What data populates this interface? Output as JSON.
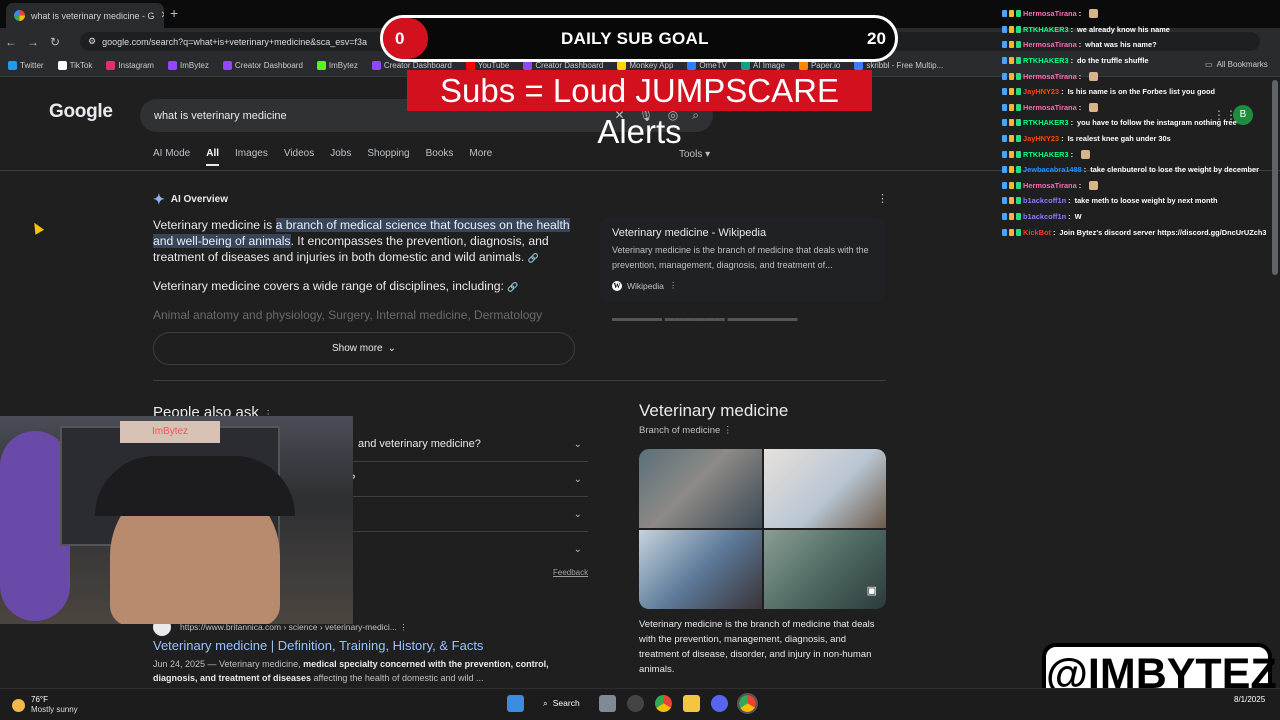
{
  "browser": {
    "tab_title": "what is veterinary medicine - G",
    "url": "google.com/search?q=what+is+veterinary+medicine&sca_esv=f3a",
    "bookmarks": [
      {
        "label": "Twitter",
        "color": "#1d9bf0"
      },
      {
        "label": "TikTok",
        "color": "#ffffff"
      },
      {
        "label": "Instagram",
        "color": "#e1306c"
      },
      {
        "label": "ImBytez",
        "color": "#9146ff"
      },
      {
        "label": "Creator Dashboard",
        "color": "#9146ff"
      },
      {
        "label": "ImBytez",
        "color": "#53fc18"
      },
      {
        "label": "Creator Dashboard",
        "color": "#9146ff"
      },
      {
        "label": "YouTube",
        "color": "#ff0000"
      },
      {
        "label": "Creator Dashboard",
        "color": "#9146ff"
      },
      {
        "label": "Monkey App",
        "color": "#ffd400"
      },
      {
        "label": "OmeTV",
        "color": "#2a7fff"
      },
      {
        "label": "AI Image",
        "color": "#10a37f"
      },
      {
        "label": "Paper.io",
        "color": "#ff8800"
      },
      {
        "label": "skribbl - Free Multip...",
        "color": "#3b7dff"
      }
    ],
    "all_bookmarks": "All Bookmarks"
  },
  "google": {
    "logo": "Google",
    "query": "what is veterinary medicine",
    "nav_tabs": [
      "AI Mode",
      "All",
      "Images",
      "Videos",
      "Jobs",
      "Shopping",
      "Books",
      "More"
    ],
    "active_tab": "All",
    "tools": "Tools",
    "ai_overview": {
      "heading": "AI Overview",
      "text_prefix": "Veterinary medicine is ",
      "text_highlight": "a branch of medical science that focuses on the health and well-being of animals",
      "text_suffix": ". It encompasses the prevention, diagnosis, and treatment of diseases and injuries in both domestic and wild animals.",
      "text2": "Veterinary medicine covers a wide range of disciplines, including:",
      "faded": "Animal anatomy and physiology, Surgery, Internal medicine, Dermatology",
      "show_more": "Show more"
    },
    "wiki_card": {
      "title": "Veterinary medicine - Wikipedia",
      "desc": "Veterinary medicine is the branch of medicine that deals with the prevention, management, diagnosis, and treatment of...",
      "source": "Wikipedia"
    },
    "people_also_ask": {
      "heading": "People also ask",
      "questions": [
        "and veterinary medicine?",
        "e?",
        "",
        ""
      ],
      "feedback": "Feedback"
    },
    "result": {
      "breadcrumb": "https://www.britannica.com › science › veterinary-medici...",
      "title": "Veterinary medicine | Definition, Training, History, & Facts",
      "date": "Jun 24, 2025 — Veterinary medicine, ",
      "bold1": "medical specialty concerned with the prevention, control, diagnosis, and treatment of diseases",
      "rest": " affecting the health of domestic and wild ..."
    },
    "knowledge_panel": {
      "title": "Veterinary medicine",
      "subtitle": "Branch of medicine",
      "desc": "Veterinary medicine is the branch of medicine that deals with the prevention, management, diagnosis, and treatment of disease, disorder, and injury in non-human animals."
    }
  },
  "overlay": {
    "goal_current": "0",
    "goal_label": "DAILY SUB GOAL",
    "goal_max": "20",
    "goal_progress": 0,
    "alert_text": "Subs = Loud JUMPSCARE Alerts",
    "webcam_sign": "ImBytez",
    "watermark": "@IMBYTEZ"
  },
  "chat": [
    {
      "user": "HermosaTirana",
      "color": "#ff69b4",
      "msg": ""
    },
    {
      "user": "RTKHAKER3",
      "color": "#00ff7f",
      "msg": "we already know his name"
    },
    {
      "user": "HermosaTirana",
      "color": "#ff69b4",
      "msg": "what was his name?"
    },
    {
      "user": "RTKHAKER3",
      "color": "#00ff7f",
      "msg": "do the truffle shuffle"
    },
    {
      "user": "HermosaTirana",
      "color": "#ff69b4",
      "msg": ""
    },
    {
      "user": "JayHNY23",
      "color": "#ff4500",
      "msg": "Is his name is on the Forbes list you good"
    },
    {
      "user": "HermosaTirana",
      "color": "#ff69b4",
      "msg": ""
    },
    {
      "user": "RTKHAKER3",
      "color": "#00ff7f",
      "msg": "you have to follow the instagram nothing free"
    },
    {
      "user": "JayHNY23",
      "color": "#ff4500",
      "msg": "Is realest knee gah under 30s"
    },
    {
      "user": "RTKHAKER3",
      "color": "#00ff7f",
      "msg": ""
    },
    {
      "user": "Jewbacabra1488",
      "color": "#1e90ff",
      "msg": "take clenbuterol to lose the weight by december"
    },
    {
      "user": "HermosaTirana",
      "color": "#ff69b4",
      "msg": ""
    },
    {
      "user": "b1ackcoff1n",
      "color": "#8a7dff",
      "msg": "take meth to loose weight by next month"
    },
    {
      "user": "b1ackcoff1n",
      "color": "#8a7dff",
      "msg": "W"
    },
    {
      "user": "KickBot",
      "color": "#ff3333",
      "msg": "Join Bytez's discord server https://discord.gg/DncUrUZch3"
    }
  ],
  "taskbar": {
    "temp": "76°F",
    "condition": "Mostly sunny",
    "search": "Search",
    "date": "8/1/2025"
  }
}
